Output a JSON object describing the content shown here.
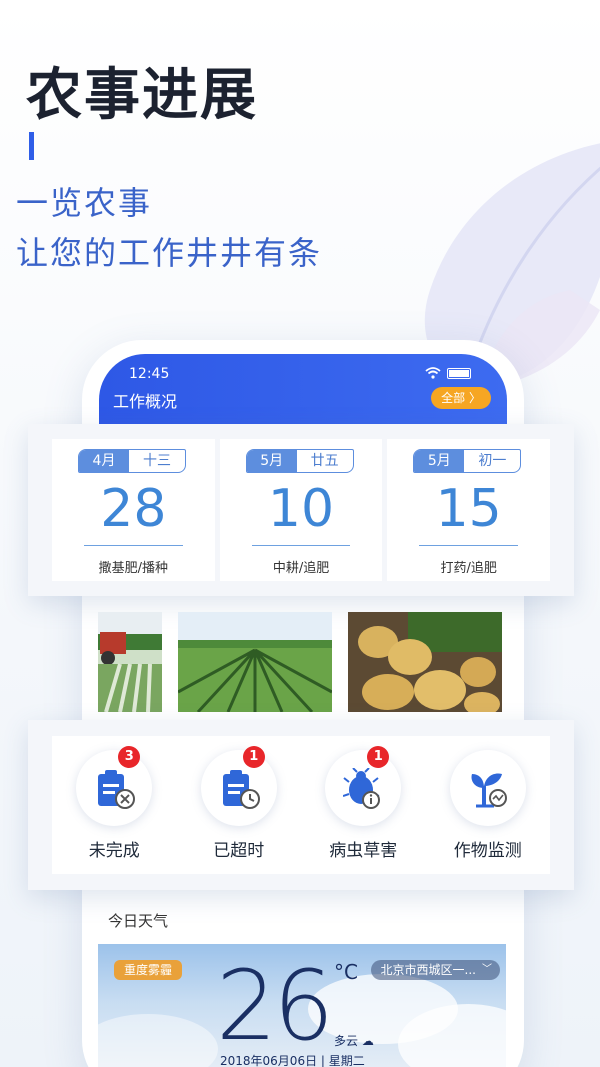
{
  "hero": {
    "title": "农事进展",
    "line1": "一览农事",
    "line2": "让您的工作井井有条"
  },
  "status": {
    "time": "12:45",
    "wifi_icon": "wifi-icon",
    "battery_icon": "battery-icon"
  },
  "header": {
    "title": "工作概况",
    "all_label": "全部 〉"
  },
  "dates": [
    {
      "month": "4月",
      "lunar": "十三",
      "day": "28",
      "task": "撒基肥/播种"
    },
    {
      "month": "5月",
      "lunar": "廿五",
      "day": "10",
      "task": "中耕/追肥"
    },
    {
      "month": "5月",
      "lunar": "初一",
      "day": "15",
      "task": "打药/追肥"
    }
  ],
  "functions": [
    {
      "label": "未完成",
      "badge": "3",
      "icon": "clipboard-cancel-icon"
    },
    {
      "label": "已超时",
      "badge": "1",
      "icon": "clipboard-clock-icon"
    },
    {
      "label": "病虫草害",
      "badge": "1",
      "icon": "pest-info-icon"
    },
    {
      "label": "作物监测",
      "badge": "",
      "icon": "plant-monitor-icon"
    }
  ],
  "weather": {
    "section_title": "今日天气",
    "alert": "重度雾霾",
    "temperature": "26",
    "unit": "°C",
    "location": "北京市西城区一...",
    "condition": "多云",
    "date": "2018年06月06日 | 星期二"
  },
  "colors": {
    "accent": "#2f5ee8",
    "orange": "#f6a623",
    "badge_red": "#e8262a",
    "date_blue": "#3e86d6"
  }
}
